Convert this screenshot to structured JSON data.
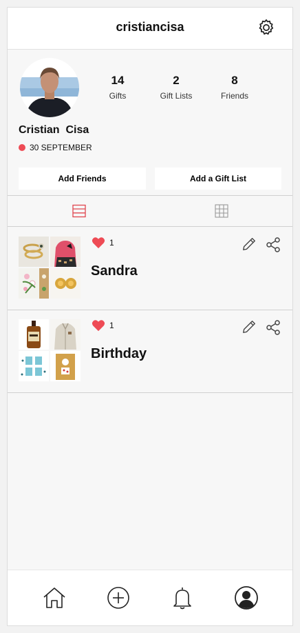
{
  "header": {
    "username": "cristiancisa",
    "settings_icon": "gear-icon"
  },
  "profile": {
    "name": "Cristian  Cisa",
    "birthday": "30 SEPTEMBER",
    "birthday_dot_color": "#ee4b55",
    "stats": [
      {
        "value": "14",
        "label": "Gifts"
      },
      {
        "value": "2",
        "label": "Gift Lists"
      },
      {
        "value": "8",
        "label": "Friends"
      }
    ],
    "add_friends_label": "Add Friends",
    "add_gift_list_label": "Add a Gift List"
  },
  "tabs": [
    {
      "icon": "list-view-icon",
      "active": true,
      "color": "#e0474f"
    },
    {
      "icon": "grid-view-icon",
      "active": false,
      "color": "#999999"
    }
  ],
  "gift_lists": [
    {
      "title": "Sandra",
      "likes": "1"
    },
    {
      "title": "Birthday",
      "likes": "1"
    }
  ],
  "bottom_nav": [
    {
      "icon": "home-icon"
    },
    {
      "icon": "add-circle-icon"
    },
    {
      "icon": "bell-icon"
    },
    {
      "icon": "profile-icon"
    }
  ],
  "colors": {
    "accent": "#e0474f",
    "heart": "#ee4b55"
  }
}
